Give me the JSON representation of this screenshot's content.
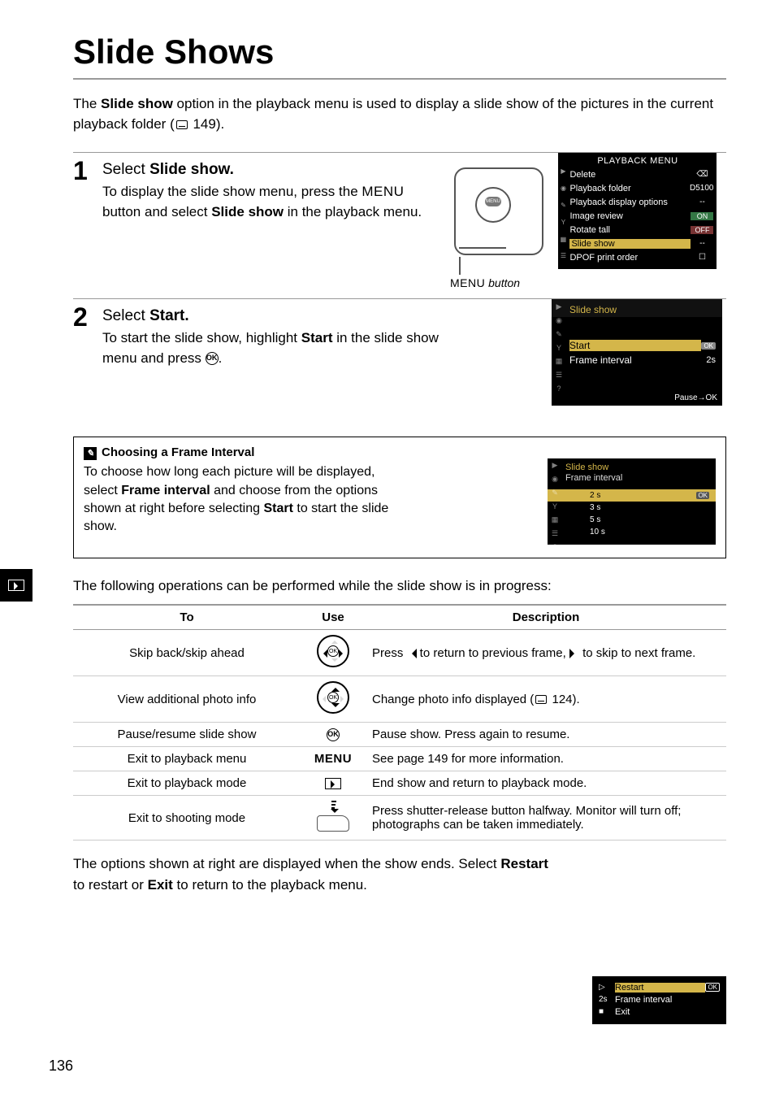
{
  "page": {
    "title": "Slide Shows",
    "intro_pre": "The ",
    "intro_bold": "Slide show",
    "intro_post": " option in the playback menu is used to display a slide show of the pictures in the current playback folder (",
    "intro_ref": "149).",
    "page_number": "136"
  },
  "tab_icon": "▶",
  "step1": {
    "num": "1",
    "title_pre": "Select ",
    "title_bold": "Slide show.",
    "text_a": "To display the slide show menu, press the ",
    "menu_word": "MENU",
    "text_b": " button and select ",
    "text_bold": "Slide show",
    "text_c": " in the playback menu.",
    "camera_btn": "MENU",
    "camera_label_a": "MENU",
    "camera_label_b": " button",
    "lcd": {
      "header": "PLAYBACK MENU",
      "rows": [
        {
          "label": "Delete",
          "val": "⌫"
        },
        {
          "label": "Playback folder",
          "val": "D5100"
        },
        {
          "label": "Playback display options",
          "val": "--"
        },
        {
          "label": "Image review",
          "val": "ON",
          "cls": "valchip"
        },
        {
          "label": "Rotate tall",
          "val": "OFF",
          "cls": "val-off"
        },
        {
          "label": "Slide show",
          "val": "--",
          "hl": true
        },
        {
          "label": "DPOF print order",
          "val": "☐"
        }
      ]
    }
  },
  "step2": {
    "num": "2",
    "title_pre": "Select ",
    "title_bold": "Start.",
    "text_a": "To start the slide show, highlight ",
    "text_bold": "Start",
    "text_b": " in the slide show menu and press ",
    "text_c": ".",
    "ok_label": "OK",
    "lcd": {
      "header": "Slide show",
      "start": "Start",
      "start_val": "OK",
      "fi": "Frame interval",
      "fi_val": "2s",
      "footer": "Pause→OK"
    }
  },
  "note": {
    "title": "Choosing a Frame Interval",
    "text_a": "To choose how long each picture will be displayed, select ",
    "text_bold": "Frame interval",
    "text_b": " and choose from the options shown at right before selecting ",
    "text_bold2": "Start",
    "text_c": " to start the slide show.",
    "lcd": {
      "header": "Slide show",
      "sub": "Frame interval",
      "opts": [
        "2 s",
        "3 s",
        "5 s",
        "10 s"
      ],
      "ok": "OK"
    }
  },
  "ops_intro": "The following operations can be performed while the slide show is in progress:",
  "table": {
    "headers": [
      "To",
      "Use",
      "Description"
    ],
    "rows": [
      {
        "to": "Skip back/skip ahead",
        "use": "dpad-lr",
        "desc_a": "Press ",
        "desc_b": " to return to previous frame, ",
        "desc_c": " to skip to next frame."
      },
      {
        "to": "View additional photo info",
        "use": "dpad-ud",
        "desc": "Change photo info displayed (",
        "desc_ref": "124)."
      },
      {
        "to": "Pause/resume slide show",
        "use": "ok",
        "desc": "Pause show.  Press again to resume."
      },
      {
        "to": "Exit to playback menu",
        "use": "menu",
        "desc": "See page 149 for more information."
      },
      {
        "to": "Exit to playback mode",
        "use": "play",
        "desc": "End show and return to playback mode."
      },
      {
        "to": "Exit to shooting mode",
        "use": "shutter",
        "desc": "Press shutter-release button halfway.  Monitor will turn off; photographs can be taken immediately."
      }
    ],
    "use_labels": {
      "ok": "OK",
      "menu": "MENU"
    }
  },
  "footer": {
    "text_a": "The options shown at right are displayed when the show ends.  Select ",
    "bold1": "Restart",
    "text_b": " to restart or ",
    "bold2": "Exit",
    "text_c": " to return to the playback menu.",
    "lcd": {
      "rows": [
        {
          "ic": "▷",
          "txt": "Restart",
          "hl": true,
          "ok": "OK"
        },
        {
          "ic": "2s",
          "txt": "Frame interval"
        },
        {
          "ic": "■",
          "txt": "Exit"
        }
      ]
    }
  }
}
